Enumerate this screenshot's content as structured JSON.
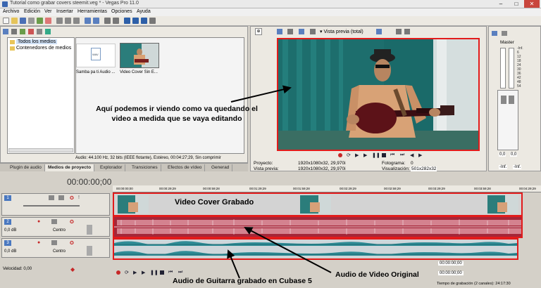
{
  "window": {
    "title": "Tutorial como grabar covers steemit.veg * - Vegas Pro 11.0",
    "min": "‒",
    "max": "□",
    "close": "✕"
  },
  "menu": [
    "Archivo",
    "Edición",
    "Ver",
    "Insertar",
    "Herramientas",
    "Opciones",
    "Ayuda"
  ],
  "explorer": {
    "tree": [
      "Todos los medios",
      "Contenedores de medios"
    ],
    "media": [
      {
        "label": "Samba pa ti Audio ...",
        "icon": "wav-file-icon",
        "badge": "WAV"
      },
      {
        "label": "Video Cover Sin E..."
      }
    ],
    "info": "Audio: 44.100 Hz, 32 bits (IEEE flotante), Estéreo, 00:04:27;29, Sin comprimir",
    "tabs": [
      "Plugin de audio",
      "Medios de proyecto",
      "Explorador",
      "Transiciones",
      "Efectos de vídeo",
      "Generad"
    ],
    "active_tab": "Medios de proyecto"
  },
  "preview": {
    "mode": "Vista previa (total)",
    "project_label": "Proyecto:",
    "project_value": "1920x1080x32, 29,970i",
    "preview_label": "Vista previa:",
    "preview_value": "1920x1080x32, 29,970i",
    "frame_label": "Fotograma:",
    "frame_value": "0",
    "view_label": "Visualización:",
    "view_value": "501x282x32"
  },
  "master": {
    "label": "Master",
    "scale": [
      "-Inf.",
      "6",
      "12",
      "18",
      "24",
      "30",
      "36",
      "42",
      "48",
      "54"
    ],
    "value_left": "0,0",
    "value_right": "0,0",
    "bottom_left": "-Inf.",
    "bottom_right": "-Inf."
  },
  "timeline": {
    "timecode": "00:00:00;00",
    "ruler": [
      "00:00:00;00",
      "00:00:29;29",
      "00:00:59;28",
      "00:01:29;29",
      "00:01:59;28",
      "00:02:29;29",
      "00:02:59;29",
      "00:03:29;29",
      "00:03:59;28",
      "00:04:29;29",
      "00:04:3"
    ],
    "tracks": [
      {
        "num": "1",
        "label": ""
      },
      {
        "num": "2",
        "db": "0,0 dB",
        "pan": "Centro"
      },
      {
        "num": "3",
        "db": "0,0 dB",
        "pan": "Centro"
      }
    ],
    "rate_label": "Velocidad: 0,00",
    "time_end_1": "00:00:00;00",
    "time_end_2": "00:00:00;00",
    "status": "Tiempo de grabación (2 canales): 24:17:30"
  },
  "annotations": {
    "preview_note": "Aquí podemos ir viendo como va quedando el video a medida que se vaya editando",
    "video_track": "Video Cover Grabado",
    "original_audio": "Audio de Video Original",
    "guitar_audio": "Audio de Guitarra grabado en Cubase 5"
  },
  "colors": {
    "highlight": "#e21b1b",
    "audio_track_2": "#a52638",
    "audio_track_3": "#2f8c96",
    "video_track": "#d3d3d3"
  }
}
